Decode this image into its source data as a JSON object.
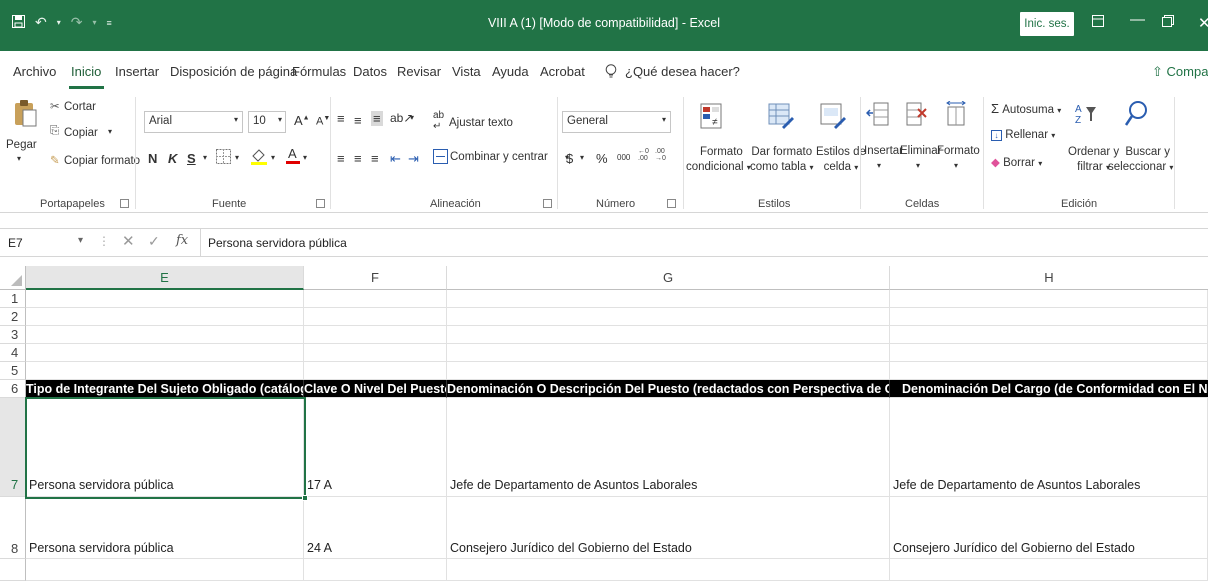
{
  "window": {
    "title": "VIII A (1)  [Modo de compatibilidad]  -  Excel",
    "sign_in": "Inic. ses."
  },
  "menu": {
    "tabs": [
      "Archivo",
      "Inicio",
      "Insertar",
      "Disposición de página",
      "Fórmulas",
      "Datos",
      "Revisar",
      "Vista",
      "Ayuda",
      "Acrobat"
    ],
    "active_tab": "Inicio",
    "search_placeholder": "¿Qué desea hacer?",
    "share": "Compartir"
  },
  "ribbon": {
    "clipboard": {
      "paste": "Pegar",
      "cut": "Cortar",
      "copy": "Copiar",
      "format_painter": "Copiar formato",
      "label": "Portapapeles"
    },
    "font": {
      "name": "Arial",
      "size": "10",
      "bold": "N",
      "italic": "K",
      "underline": "S",
      "label": "Fuente"
    },
    "alignment": {
      "wrap": "Ajustar texto",
      "merge": "Combinar y centrar",
      "label": "Alineación"
    },
    "number": {
      "format": "General",
      "label": "Número"
    },
    "styles": {
      "conditional_1": "Formato",
      "conditional_2": "condicional",
      "as_table_1": "Dar formato",
      "as_table_2": "como tabla",
      "cell_styles_1": "Estilos de",
      "cell_styles_2": "celda",
      "label": "Estilos"
    },
    "cells": {
      "insert": "Insertar",
      "delete": "Eliminar",
      "format": "Formato",
      "label": "Celdas"
    },
    "editing": {
      "autosum": "Autosuma",
      "fill": "Rellenar",
      "clear": "Borrar",
      "sort_1": "Ordenar y",
      "sort_2": "filtrar",
      "find_1": "Buscar y",
      "find_2": "seleccionar",
      "label": "Edición"
    }
  },
  "formula_bar": {
    "name_box": "E7",
    "content": "Persona servidora pública"
  },
  "sheet": {
    "columns": [
      "E",
      "F",
      "G",
      "H"
    ],
    "selected_column": "E",
    "row_numbers": [
      "1",
      "2",
      "3",
      "4",
      "5",
      "6",
      "7",
      "8"
    ],
    "header_row": [
      "Tipo de Integrante Del Sujeto Obligado (catálogo)",
      "Clave O Nivel Del Puesto",
      "Denominación O Descripción Del Puesto (redactados con Perspectiva de Género)",
      "Denominación Del Cargo (de Conformidad con El Nombram"
    ],
    "rows": [
      [
        "Persona servidora pública",
        "17 A",
        "Jefe de Departamento de Asuntos Laborales",
        "Jefe de Departamento de Asuntos Laborales"
      ],
      [
        "Persona servidora pública",
        "24 A",
        "Consejero Jurídico del Gobierno del Estado",
        "Consejero Jurídico del Gobierno del Estado"
      ]
    ]
  }
}
